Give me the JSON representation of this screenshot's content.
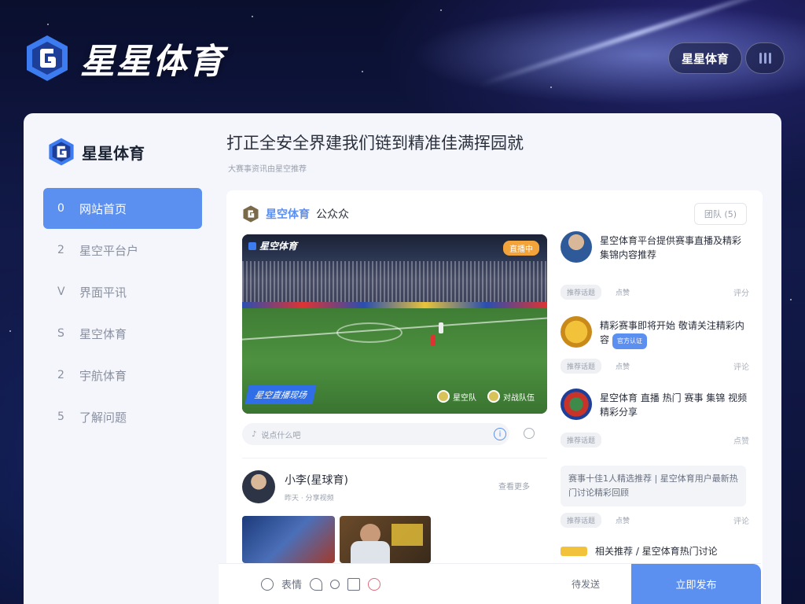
{
  "header": {
    "brand": "星星体育",
    "pill_label": "星星体育"
  },
  "sidebar": {
    "brand": "星星体育",
    "items": [
      {
        "num": "0",
        "label": "网站首页",
        "active": true
      },
      {
        "num": "2",
        "label": "星空平台户"
      },
      {
        "num": "V",
        "label": "界面平讯"
      },
      {
        "num": "S",
        "label": "星空体育"
      },
      {
        "num": "2",
        "label": "宇航体育"
      },
      {
        "num": "5",
        "label": "了解问题"
      }
    ]
  },
  "main": {
    "title": "打正全安全界建我们链到精准佳满挥园就",
    "subtitle": "大赛事资讯由星空推荐"
  },
  "panel": {
    "account_brand": "星空体育",
    "account_suffix": "公众众",
    "corner_button": "团队 (5)",
    "video": {
      "logo": "星空体育",
      "live_badge": "直播中",
      "tag": "星空直播现场",
      "team_a": "星空队",
      "team_b": "对战队伍"
    },
    "comment_placeholder": "说点什么吧",
    "info_icon_glyph": "i",
    "post": {
      "user": "小李(星球育)",
      "meta": "昨天 · 分享视频",
      "more": "查看更多"
    }
  },
  "right_column": [
    {
      "text": "星空体育平台提供赛事直播及精彩集锦内容推荐",
      "tag": "推荐话题",
      "tag2": "点赞",
      "tip": "评分"
    },
    {
      "text": "精彩赛事即将开始 敬请关注精彩内容",
      "badge": "官方认证",
      "tag": "推荐话题",
      "tag2": "点赞",
      "tip": "评论"
    },
    {
      "text": "星空体育 直播 热门 赛事 集锦 视频 精彩分享",
      "tag": "推荐话题",
      "tag2": "",
      "tip": "点赞"
    },
    {
      "quote": "赛事十佳1人精选推荐 | 星空体育用户最新热门讨论精彩回顾",
      "tag": "推荐话题",
      "tag2": "点赞",
      "tip": "评论"
    },
    {
      "text": "相关推荐 / 星空体育热门讨论",
      "tag": ""
    }
  ],
  "bottom_bar": {
    "tools_label": "表情",
    "cancel": "待发送",
    "submit": "立即发布"
  },
  "colors": {
    "accent": "#5b8ff0",
    "card_bg": "#f4f6fb",
    "page_bg": "#0b1030"
  },
  "icons": [
    "logo-icon",
    "music-bars-icon",
    "info-icon",
    "emoji-icon",
    "at-icon",
    "image-icon"
  ]
}
